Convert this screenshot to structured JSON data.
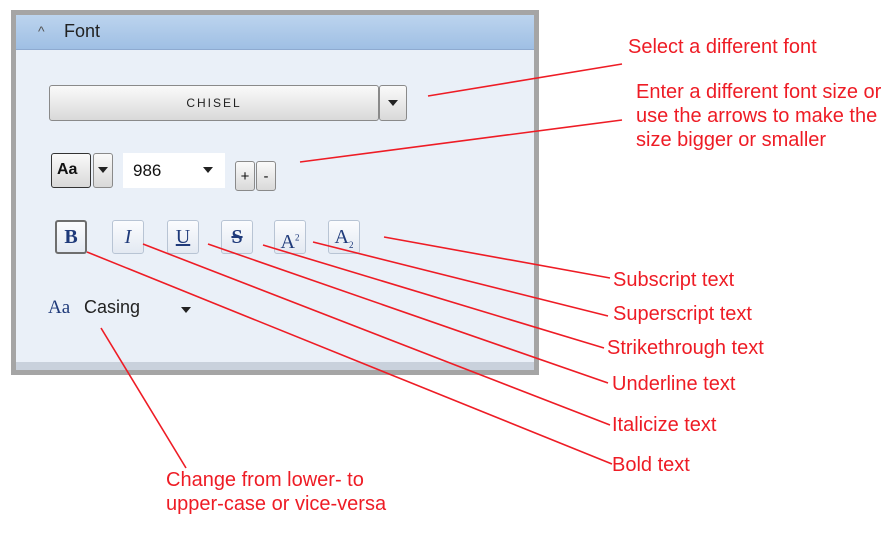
{
  "panel": {
    "title": "Font",
    "font_name": "Chisel",
    "size_style_label": "Aa",
    "font_size": "986",
    "increase_label": "+",
    "decrease_label": "-",
    "format_buttons": {
      "bold": "B",
      "italic": "I",
      "underline": "U",
      "strike": "S",
      "superscript": "A",
      "superscript_sup": "2",
      "subscript": "A",
      "subscript_sub": "2"
    },
    "casing_icon": "Aa",
    "casing_label": "Casing"
  },
  "annotations": {
    "select_font": "Select a different font",
    "font_size": "Enter a different font size or use the arrows to make the size bigger or smaller",
    "subscript": "Subscript text",
    "superscript": "Superscript text",
    "strikethrough": "Strikethrough text",
    "underline": "Underline text",
    "italicize": "Italicize text",
    "bold": "Bold text",
    "casing": "Change from lower- to upper-case or vice-versa"
  },
  "colors": {
    "annotation": "#ee1c25",
    "panel_bg": "#eaf0f8",
    "header_bg": "#9fbfe4",
    "icon_blue": "#1f3a7a"
  }
}
